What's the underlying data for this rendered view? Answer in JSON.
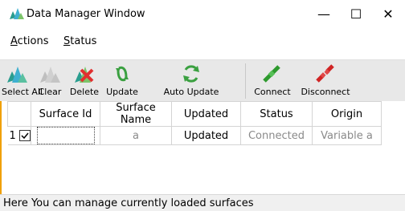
{
  "window": {
    "title": "Data Manager Window",
    "minimize_glyph": "—",
    "maximize_glyph": "☐",
    "close_glyph": "✕"
  },
  "menu": {
    "actions": {
      "underlined": "A",
      "rest": "ctions"
    },
    "status": {
      "underlined": "S",
      "rest": "tatus"
    }
  },
  "toolbar": {
    "select_all": "Select All",
    "clear": "Clear",
    "delete": "Delete",
    "update": "Update",
    "auto_update": "Auto Update",
    "connect": "Connect",
    "disconnect": "Disconnect"
  },
  "grid": {
    "columns": [
      "Surface Id",
      "Surface Name",
      "Updated",
      "Status",
      "Origin"
    ],
    "rows": [
      {
        "index": "1",
        "checked": true,
        "surface_id": "",
        "surface_name": "a",
        "updated": "Updated",
        "status": "Connected",
        "origin": "Variable a"
      }
    ]
  },
  "statusbar": {
    "text": "Here You can manage currently loaded surfaces"
  },
  "colors": {
    "accent_border": "#f0a000",
    "toolbar_bg": "#e8e8e8",
    "muted_text": "#8a8a8a"
  }
}
